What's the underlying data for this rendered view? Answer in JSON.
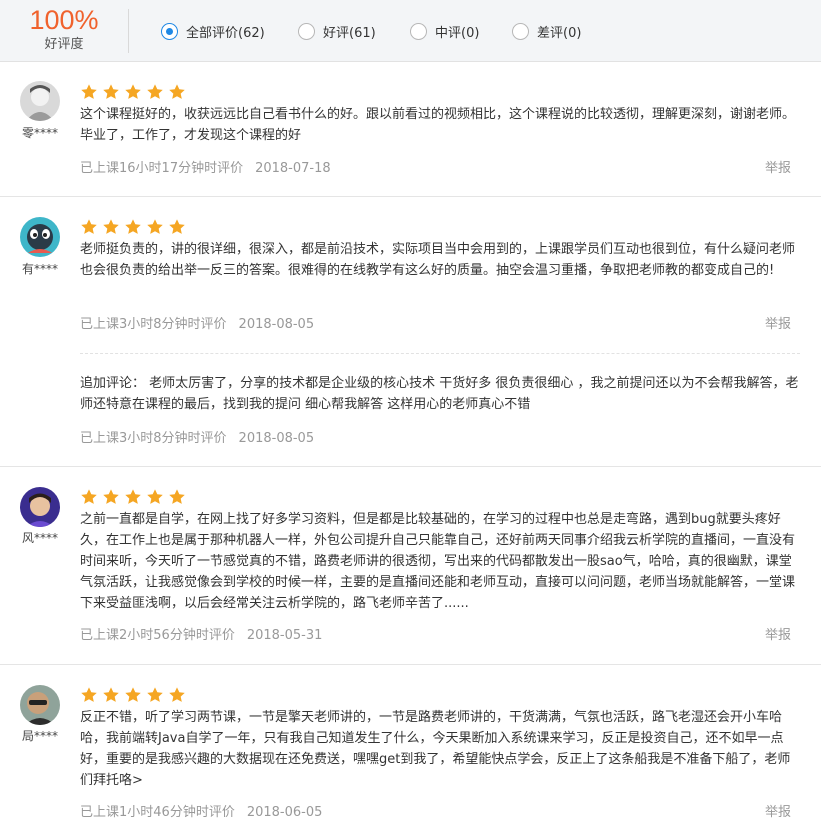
{
  "summary": {
    "percent": "100%",
    "label": "好评度"
  },
  "filters": [
    {
      "label": "全部评价(62)",
      "selected": true
    },
    {
      "label": "好评(61)",
      "selected": false
    },
    {
      "label": "中评(0)",
      "selected": false
    },
    {
      "label": "差评(0)",
      "selected": false
    }
  ],
  "colors": {
    "accent": "#f0622d",
    "star": "#f5a623",
    "radio": "#1e88e5"
  },
  "reviews": [
    {
      "user": "零****",
      "rating": 5,
      "content": "这个课程挺好的，收获远远比自己看书什么的好。跟以前看过的视频相比，这个课程说的比较透彻，理解更深刻，谢谢老师。毕业了，工作了，才发现这个课程的好",
      "study_time": "已上课16小时17分钟时评价",
      "date": "2018-07-18",
      "report": "举报"
    },
    {
      "user": "有****",
      "rating": 5,
      "content": " 老师挺负责的，讲的很详细，很深入，都是前沿技术，实际项目当中会用到的，上课跟学员们互动也很到位，有什么疑问老师也会很负责的给出举一反三的答案。很难得的在线教学有这么好的质量。抽空会温习重播，争取把老师教的都变成自己的!",
      "study_time": "已上课3小时8分钟时评价",
      "date": "2018-08-05",
      "report": "举报",
      "followup": {
        "content": "追加评论： 老师太厉害了，分享的技术都是企业级的核心技术 干货好多 很负责很细心 ，我之前提问还以为不会帮我解答，老师还特意在课程的最后，找到我的提问 细心帮我解答 这样用心的老师真心不错",
        "study_time": "已上课3小时8分钟时评价",
        "date": "2018-08-05"
      }
    },
    {
      "user": "风****",
      "rating": 5,
      "content": "之前一直都是自学，在网上找了好多学习资料，但是都是比较基础的，在学习的过程中也总是走弯路，遇到bug就要头疼好久，在工作上也是属于那种机器人一样，外包公司提升自己只能靠自己，还好前两天同事介绍我云析学院的直播间，一直没有时间来听，今天听了一节感觉真的不错，路费老师讲的很透彻，写出来的代码都散发出一股sao气，哈哈，真的很幽默，课堂气氛活跃，让我感觉像会到学校的时候一样，主要的是直播间还能和老师互动，直接可以问问题，老师当场就能解答，一堂课下来受益匪浅啊，以后会经常关注云析学院的，路飞老师辛苦了......",
      "study_time": "已上课2小时56分钟时评价",
      "date": "2018-05-31",
      "report": "举报"
    },
    {
      "user": "局****",
      "rating": 5,
      "content": "反正不错，听了学习两节课，一节是擎天老师讲的，一节是路费老师讲的，干货满满，气氛也活跃，路飞老湿还会开小车哈哈，我前端转Java自学了一年，只有我自己知道发生了什么，今天果断加入系统课来学习，反正是投资自己，还不如早一点好，重要的是我感兴趣的大数据现在还免费送，嘿嘿get到我了，希望能快点学会，反正上了这条船我是不准备下船了，老师们拜托咯>",
      "study_time": "已上课1小时46分钟时评价",
      "date": "2018-06-05",
      "report": "举报"
    }
  ]
}
